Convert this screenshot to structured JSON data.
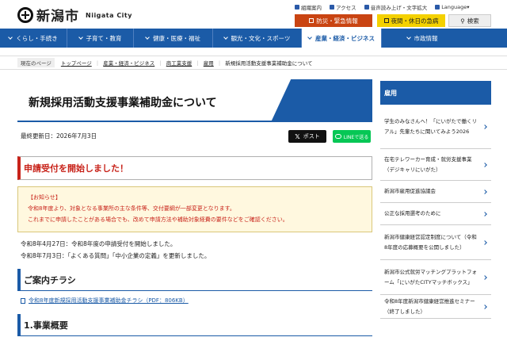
{
  "header": {
    "logo_text": "新潟市",
    "logo_sub": "Niigata City",
    "util_links": [
      "組織案内",
      "アクセス",
      "音声読み上げ・文字拡大",
      "Language"
    ],
    "emergency_label": "防災・緊急情報",
    "hospital_label": "夜間・休日の急病",
    "search_label": "検索"
  },
  "nav": {
    "items": [
      {
        "label": "くらし・手続き"
      },
      {
        "label": "子育て・教育"
      },
      {
        "label": "健康・医療・福祉"
      },
      {
        "label": "観光・文化・スポーツ"
      },
      {
        "label": "産業・経済・ビジネス"
      },
      {
        "label": "市政情報"
      }
    ],
    "active_index": 4
  },
  "breadcrumb": {
    "here": "現在のページ",
    "links": [
      "トップページ",
      "産業・経済・ビジネス",
      "商工業支援",
      "雇用"
    ],
    "current": "新規採用活動支援事業補助金について"
  },
  "page": {
    "title": "新規採用活動支援事業補助金について",
    "updated": "最終更新日：2026年7月3日",
    "x_label": "ポスト",
    "line_label": "LINEで送る",
    "notice_title": "申請受付を開始しました！",
    "notice_heading": "【お知らせ】",
    "notice_lines": [
      "令和8年度より、対象となる事業所の主な条件等、交付要綱が一部変更となります。",
      "これまでに申請したことがある場合でも、改めて申請方法や補助対象経費の要件などをご確認ください。"
    ],
    "body_lines": [
      "令和8年4月27日：令和8年度の申請受付を開始しました。",
      "令和8年7月3日：「よくある質問」「中小企業の定義」を更新しました。"
    ],
    "section1": "ご案内チラシ",
    "pdf_link": "令和8年度新規採用活動支援事業補助金チラシ（PDF：806KB）",
    "section2": "1.事業概要"
  },
  "sidebar": {
    "heading": "雇用",
    "items": [
      "学生のみなさんへ！「にいがたで働くリアル」先輩たちに聞いてみよう2026",
      "在宅テレワーカー育成・就労支援事業（デジキャリにいがた）",
      "新潟市雇用促進協議会",
      "公正な採用選考のために",
      "新潟市健康経営認定制度について（令和8年度の応募概要を公開しました）",
      "新潟市公式就労マッチングプラットフォーム「にいがたCITYマッチボックス」",
      "令和8年度新潟市健康経営推進セミナー（終了しました）"
    ]
  }
}
